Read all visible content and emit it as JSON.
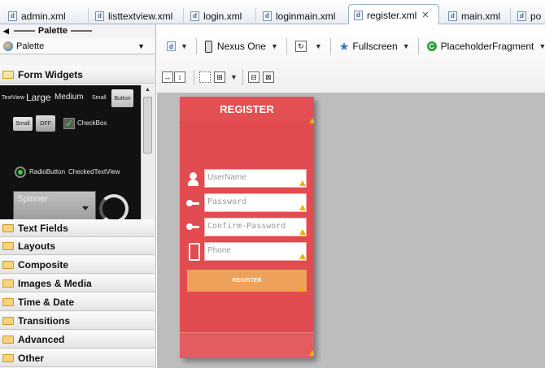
{
  "editor_tabs": [
    {
      "label": "admin.xml",
      "active": false
    },
    {
      "label": "listtextview.xml",
      "active": false
    },
    {
      "label": "login.xml",
      "active": false
    },
    {
      "label": "loginmain.xml",
      "active": false
    },
    {
      "label": "register.xml",
      "active": true,
      "close_glyph": "✕"
    },
    {
      "label": "main.xml",
      "active": false
    },
    {
      "label": "po",
      "active": false
    }
  ],
  "palette": {
    "title": "Palette",
    "selector_label": "Palette",
    "categories": [
      {
        "label": "Form Widgets",
        "expanded": true
      },
      {
        "label": "Text Fields"
      },
      {
        "label": "Layouts"
      },
      {
        "label": "Composite"
      },
      {
        "label": "Images & Media"
      },
      {
        "label": "Time & Date"
      },
      {
        "label": "Transitions"
      },
      {
        "label": "Advanced"
      },
      {
        "label": "Other"
      }
    ],
    "form_widgets": {
      "textview": "TextView",
      "large": "Large",
      "medium": "Medium",
      "small": "Small",
      "button": "Button",
      "small_button": "Small",
      "toggle_off": "OFF",
      "checkbox": "CheckBox",
      "radiobutton": "RadioButton",
      "checkedtextview": "CheckedTextView",
      "spinner": "Spinner"
    }
  },
  "toolbar": {
    "device": "Nexus One",
    "fullscreen": "Fullscreen",
    "fragment": "PlaceholderFragment"
  },
  "device_preview": {
    "title": "REGISTER",
    "fields": [
      {
        "placeholder": "UserName",
        "icon": "user-icon"
      },
      {
        "placeholder": "Password",
        "icon": "key-icon"
      },
      {
        "placeholder": "Confirm-Password",
        "icon": "key-icon"
      },
      {
        "placeholder": "Phone",
        "icon": "phone-icon"
      }
    ],
    "button": "REGISTER"
  },
  "colors": {
    "device_background": "#e24b4f",
    "register_button": "#eda15a",
    "canvas": "#bdbdbd",
    "warning": "#e7b400"
  }
}
